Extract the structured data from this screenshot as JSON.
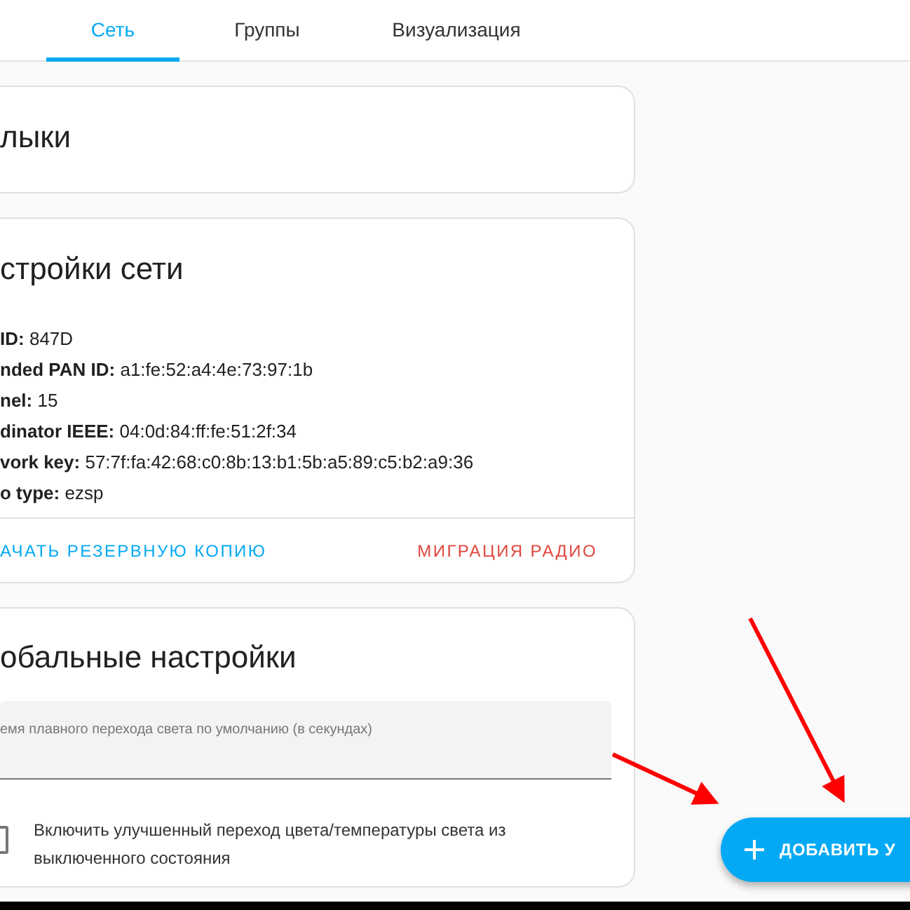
{
  "tabs": [
    {
      "label": "Сеть",
      "selected": true
    },
    {
      "label": "Группы",
      "selected": false
    },
    {
      "label": "Визуализация",
      "selected": false
    }
  ],
  "cards": [
    {
      "title": "лыки"
    },
    {
      "title": "стройки сети",
      "info": [
        {
          "label": "ID:",
          "value": "847D"
        },
        {
          "label": "nded PAN ID:",
          "value": "a1:fe:52:a4:4e:73:97:1b"
        },
        {
          "label": "nel:",
          "value": "15"
        },
        {
          "label": "dinator IEEE:",
          "value": "04:0d:84:ff:fe:51:2f:34"
        },
        {
          "label": "vork key:",
          "value": "57:7f:fa:42:68:c0:8b:13:b1:5b:a5:89:c5:b2:a9:36"
        },
        {
          "label": "o type:",
          "value": "ezsp"
        }
      ],
      "actions": [
        {
          "label": "АЧАТЬ РЕЗЕРВНУЮ КОПИЮ",
          "kind": "primary"
        },
        {
          "label": "МИГРАЦИЯ РАДИО",
          "kind": "danger"
        }
      ]
    },
    {
      "title": "обальные настройки",
      "field": {
        "label": "емя плавного перехода света по умолчанию (в секундах)"
      },
      "checkbox": {
        "label": "Включить улучшенный переход цвета/температуры света из выключенного состояния",
        "checked": false
      }
    }
  ],
  "fab": {
    "label": "ДОБАВИТЬ У"
  }
}
